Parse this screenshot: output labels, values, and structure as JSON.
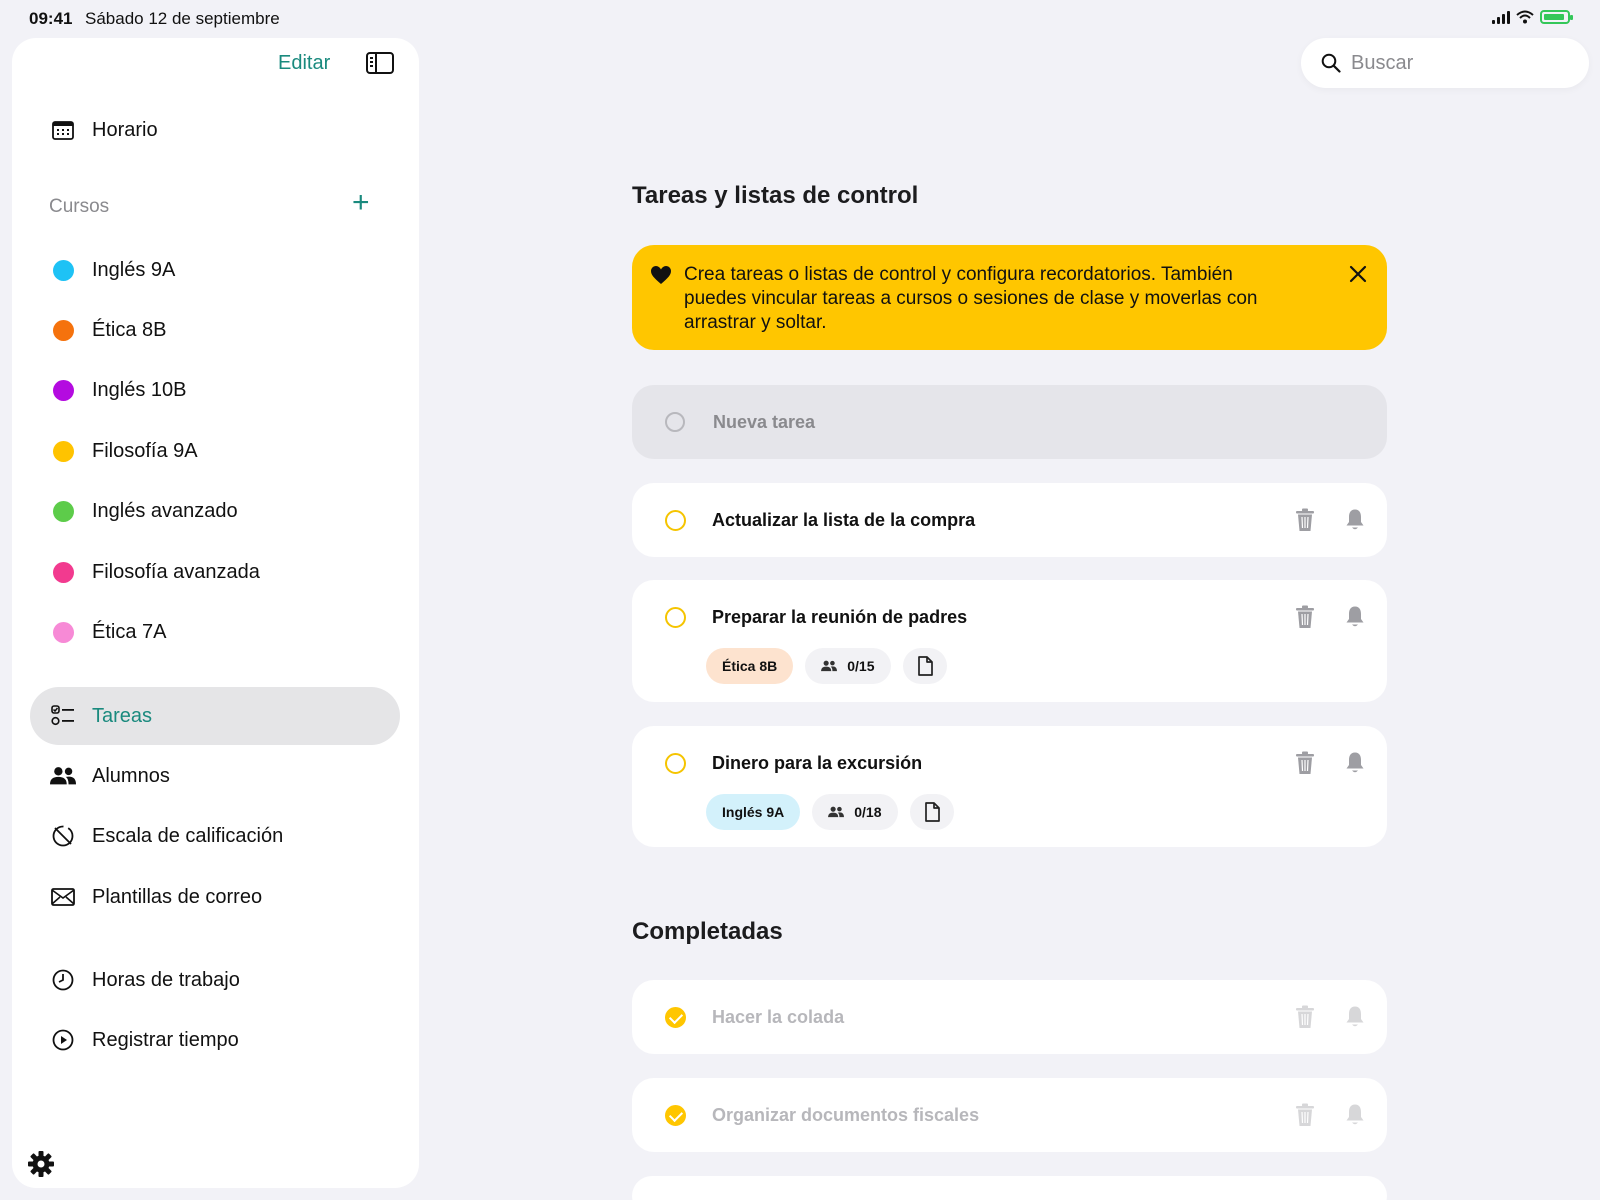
{
  "status_bar": {
    "time": "09:41",
    "date": "Sábado 12 de septiembre"
  },
  "sidebar": {
    "edit_label": "Editar",
    "schedule_label": "Horario",
    "courses_heading": "Cursos",
    "courses": [
      {
        "label": "Inglés 9A",
        "color": "#1ec2f5"
      },
      {
        "label": "Ética 8B",
        "color": "#f5720d"
      },
      {
        "label": "Inglés 10B",
        "color": "#b40be0"
      },
      {
        "label": "Filosofía 9A",
        "color": "#ffc300"
      },
      {
        "label": "Inglés avanzado",
        "color": "#5dcc4a"
      },
      {
        "label": "Filosofía avanzada",
        "color": "#f23a8f"
      },
      {
        "label": "Ética 7A",
        "color": "#f78ad6"
      }
    ],
    "nav": {
      "tasks": "Tareas",
      "students": "Alumnos",
      "grading": "Escala de calificación",
      "mail_templates": "Plantillas de correo",
      "work_hours": "Horas de trabajo",
      "log_time": "Registrar tiempo"
    }
  },
  "search": {
    "placeholder": "Buscar"
  },
  "main": {
    "title": "Tareas y listas de control",
    "banner_text": "Crea tareas o listas de control y configura recordatorios. También puedes vincular tareas a cursos o sesiones de clase y moverlas con arrastrar y soltar.",
    "new_task_placeholder": "Nueva tarea",
    "tasks": [
      {
        "title": "Actualizar la lista de la compra"
      },
      {
        "title": "Preparar la reunión de padres",
        "course": "Ética 8B",
        "course_bg": "#fde3cf",
        "count": "0/15"
      },
      {
        "title": "Dinero para la excursión",
        "course": "Inglés 9A",
        "course_bg": "#d3f1fb",
        "count": "0/18"
      }
    ],
    "completed_title": "Completadas",
    "completed": [
      {
        "title": "Hacer la colada"
      },
      {
        "title": "Organizar documentos fiscales"
      }
    ]
  },
  "colors": {
    "accent": "#1a8a7e",
    "banner": "#ffc600",
    "background": "#f2f2f7"
  }
}
